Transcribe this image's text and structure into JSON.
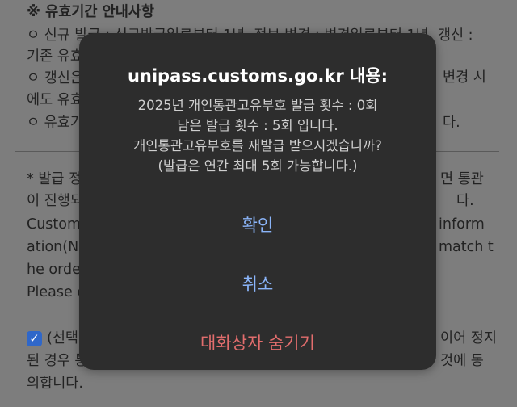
{
  "background": {
    "lines": [
      "※ 유효기간 안내사항",
      "ㅇ 신규 발급 : 신규발급일로부터 1년, 정보 변경 : 변경일로부터 1년, 갱신 :",
      "기존 유효",
      "ㅇ 갱신은",
      "에도 유효",
      "ㅇ 유효기",
      "* 발급 정",
      "이 진행되",
      "Customs",
      "ation(Na",
      "he order",
      "Please e",
      "(선택",
      "된 경우 통",
      "의합니다."
    ],
    "right_fragments": [
      "변경 시",
      "다.",
      "면 통관",
      "다.",
      "inform",
      "match t",
      "이어 정지",
      "것에 동"
    ],
    "checkbox_checked": true
  },
  "dialog": {
    "title": "unipass.customs.go.kr 내용:",
    "message_lines": [
      "2025년 개인통관고유부호 발급 횟수 : 0회",
      "남은 발급 횟수 : 5회 입니다.",
      "개인통관고유부호를 재발급 받으시겠습니까?",
      "(발급은 연간 최대 5회 가능합니다.)"
    ],
    "buttons": {
      "confirm": "확인",
      "cancel": "취소",
      "hide": "대화상자 숨기기"
    }
  },
  "colors": {
    "dialog_bg": "#2d2d2d",
    "button_blue": "#8ab4f8",
    "button_red": "#e26d6d",
    "checkbox_blue": "#2f67c9"
  }
}
